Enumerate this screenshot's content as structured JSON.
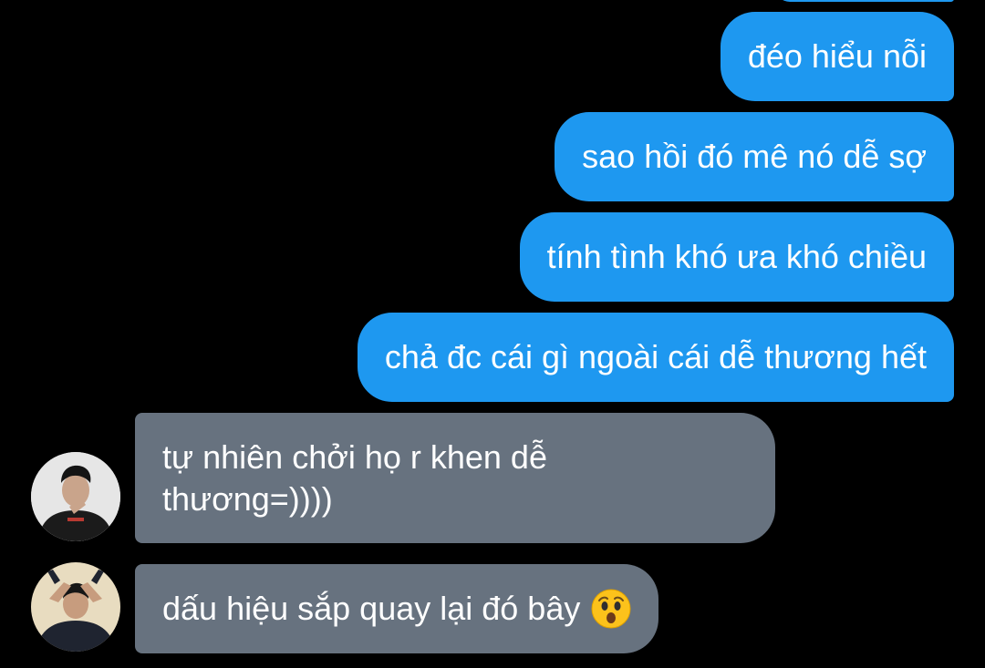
{
  "conversation": {
    "outgoing": [
      {
        "text": "đéo hiểu nỗi"
      },
      {
        "text": "sao hồi đó mê nó dễ sợ"
      },
      {
        "text": "tính tình khó ưa khó chiều"
      },
      {
        "text": "chả đc cái gì ngoài cái dễ thương hết"
      }
    ],
    "incoming": [
      {
        "lines": [
          "tự nhiên chởi họ r khen dễ",
          "thương=))))"
        ],
        "avatar_icon": "user-avatar-icon"
      },
      {
        "text": "dấu hiệu sắp quay lại đó bây",
        "emoji": "astonished-face-icon",
        "avatar_icon": "user-avatar-icon"
      }
    ]
  },
  "colors": {
    "background": "#000000",
    "outgoing_bubble": "#1e98f0",
    "incoming_bubble": "#67727f",
    "text": "#ffffff"
  }
}
